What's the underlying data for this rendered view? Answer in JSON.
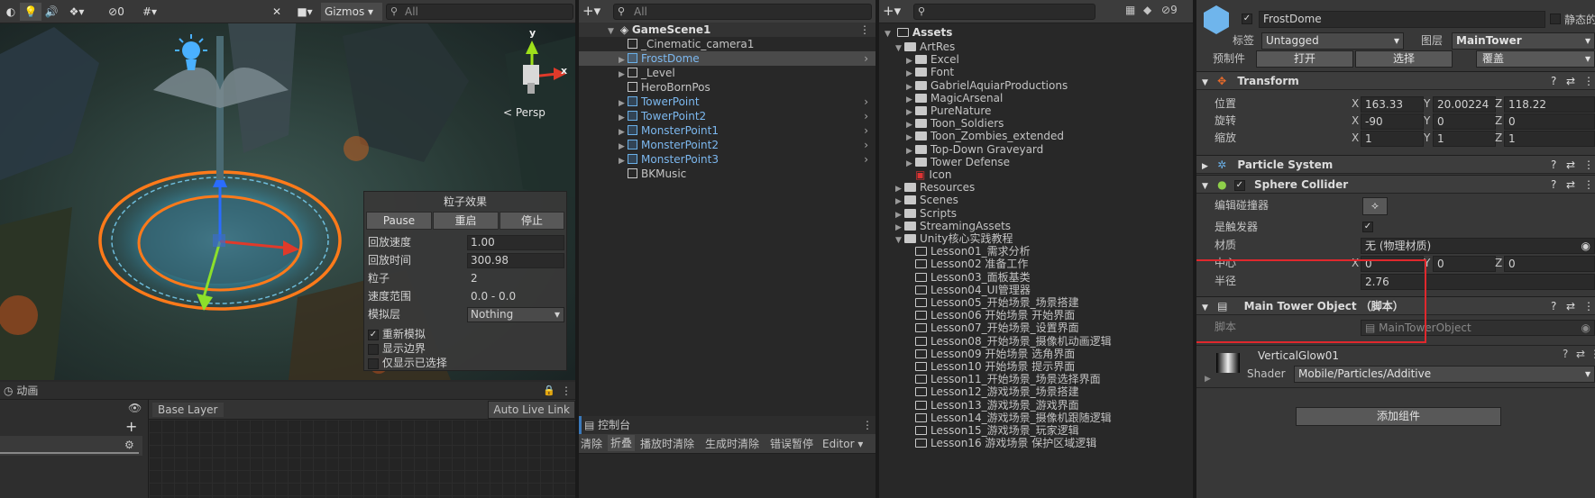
{
  "scene": {
    "toolbar": {
      "gizmos_label": "Gizmos",
      "search_placeholder": "All",
      "hidden_count": "0"
    },
    "persp_label": "< Persp",
    "axis_y": "y",
    "axis_x": "x",
    "particle_panel": {
      "title": "粒子效果",
      "pause": "Pause",
      "restart": "重启",
      "stop": "停止",
      "rows": [
        {
          "label": "回放速度",
          "value": "1.00"
        },
        {
          "label": "回放时间",
          "value": "300.98"
        },
        {
          "label": "粒子",
          "value": "2"
        },
        {
          "label": "速度范围",
          "value": "0.0 - 0.0"
        },
        {
          "label": "模拟层",
          "value": "Nothing"
        }
      ],
      "checks": [
        {
          "label": "重新模拟",
          "checked": true
        },
        {
          "label": "显示边界",
          "checked": false
        },
        {
          "label": "仅显示已选择",
          "checked": false
        }
      ]
    }
  },
  "animator": {
    "tab": "动画",
    "layer": "Base Layer",
    "auto_live_link": "Auto Live Link"
  },
  "hierarchy": {
    "search_placeholder": "All",
    "scene_name": "GameScene1",
    "items": [
      {
        "name": "_Cinematic_camera1",
        "prefab": false,
        "expandable": false
      },
      {
        "name": "FrostDome",
        "prefab": true,
        "expandable": true,
        "selected": true
      },
      {
        "name": "_Level",
        "prefab": false,
        "expandable": true
      },
      {
        "name": "HeroBornPos",
        "prefab": false,
        "expandable": false
      },
      {
        "name": "TowerPoint",
        "prefab": true,
        "expandable": true
      },
      {
        "name": "TowerPoint2",
        "prefab": true,
        "expandable": true
      },
      {
        "name": "MonsterPoint1",
        "prefab": true,
        "expandable": true
      },
      {
        "name": "MonsterPoint2",
        "prefab": true,
        "expandable": true
      },
      {
        "name": "MonsterPoint3",
        "prefab": true,
        "expandable": true
      },
      {
        "name": "BKMusic",
        "prefab": false,
        "expandable": false
      }
    ]
  },
  "console": {
    "tab": "控制台",
    "buttons": [
      "清除",
      "折叠",
      "播放时清除",
      "生成时清除",
      "错误暂停",
      "Editor ▾"
    ]
  },
  "project": {
    "hidden_count": "9",
    "root": "Assets",
    "items": [
      {
        "name": "ArtRes",
        "level": 1,
        "open": true
      },
      {
        "name": "Excel",
        "level": 2
      },
      {
        "name": "Font",
        "level": 2
      },
      {
        "name": "GabrielAquiarProductions",
        "level": 2
      },
      {
        "name": "MagicArsenal",
        "level": 2
      },
      {
        "name": "PureNature",
        "level": 2
      },
      {
        "name": "Toon_Soldiers",
        "level": 2
      },
      {
        "name": "Toon_Zombies_extended",
        "level": 2
      },
      {
        "name": "Top-Down Graveyard",
        "level": 2
      },
      {
        "name": "Tower Defense",
        "level": 2
      },
      {
        "name": "Icon",
        "level": 2,
        "file": true
      },
      {
        "name": "Resources",
        "level": 1
      },
      {
        "name": "Scenes",
        "level": 1
      },
      {
        "name": "Scripts",
        "level": 1
      },
      {
        "name": "StreamingAssets",
        "level": 1
      },
      {
        "name": "Unity核心实践教程",
        "level": 1,
        "open": true
      },
      {
        "name": "Lesson01_需求分析",
        "level": 2,
        "leaf": true
      },
      {
        "name": "Lesson02 准备工作",
        "level": 2,
        "leaf": true
      },
      {
        "name": "Lesson03_面板基类",
        "level": 2,
        "leaf": true
      },
      {
        "name": "Lesson04_UI管理器",
        "level": 2,
        "leaf": true
      },
      {
        "name": "Lesson05_开始场景_场景搭建",
        "level": 2,
        "leaf": true
      },
      {
        "name": "Lesson06 开始场景 开始界面",
        "level": 2,
        "leaf": true
      },
      {
        "name": "Lesson07_开始场景_设置界面",
        "level": 2,
        "leaf": true
      },
      {
        "name": "Lesson08_开始场景_摄像机动画逻辑",
        "level": 2,
        "leaf": true
      },
      {
        "name": "Lesson09 开始场景 选角界面",
        "level": 2,
        "leaf": true
      },
      {
        "name": "Lesson10 开始场景 提示界面",
        "level": 2,
        "leaf": true
      },
      {
        "name": "Lesson11_开始场景_场景选择界面",
        "level": 2,
        "leaf": true
      },
      {
        "name": "Lesson12_游戏场景_场景搭建",
        "level": 2,
        "leaf": true
      },
      {
        "name": "Lesson13_游戏场景_游戏界面",
        "level": 2,
        "leaf": true
      },
      {
        "name": "Lesson14_游戏场景_摄像机跟随逻辑",
        "level": 2,
        "leaf": true
      },
      {
        "name": "Lesson15_游戏场景_玩家逻辑",
        "level": 2,
        "leaf": true
      },
      {
        "name": "Lesson16 游戏场景 保护区域逻辑",
        "level": 2,
        "leaf": true
      }
    ]
  },
  "inspector": {
    "object_name": "FrostDome",
    "static_label": "静态的",
    "tag_label": "标签",
    "tag_value": "Untagged",
    "layer_label": "图层",
    "layer_value": "MainTower",
    "prefab_label": "预制件",
    "open_btn": "打开",
    "select_btn": "选择",
    "override_btn": "覆盖",
    "transform": {
      "title": "Transform",
      "position_label": "位置",
      "rotation_label": "旋转",
      "scale_label": "缩放",
      "position": {
        "x": "163.33",
        "y": "20.00224",
        "z": "118.22"
      },
      "rotation": {
        "x": "-90",
        "y": "0",
        "z": "0"
      },
      "scale": {
        "x": "1",
        "y": "1",
        "z": "1"
      }
    },
    "particle_system": {
      "title": "Particle System"
    },
    "sphere_collider": {
      "title": "Sphere Collider",
      "edit_label": "编辑碰撞器",
      "trigger_label": "是触发器",
      "material_label": "材质",
      "material_value": "无 (物理材质)",
      "center_label": "中心",
      "center": {
        "x": "0",
        "y": "0",
        "z": "0"
      },
      "radius_label": "半径",
      "radius_value": "2.76"
    },
    "main_tower": {
      "title": "Main Tower Object （脚本）",
      "script_label": "脚本",
      "script_value": "MainTowerObject"
    },
    "material": {
      "name": "VerticalGlow01",
      "shader_label": "Shader",
      "shader_value": "Mobile/Particles/Additive"
    },
    "add_component": "添加组件",
    "axis": {
      "x": "X",
      "y": "Y",
      "z": "Z"
    }
  },
  "colors": {
    "highlight_box": "#e0282d",
    "selection": "#2c5d87",
    "prefab_blue": "#7cb8ef"
  }
}
